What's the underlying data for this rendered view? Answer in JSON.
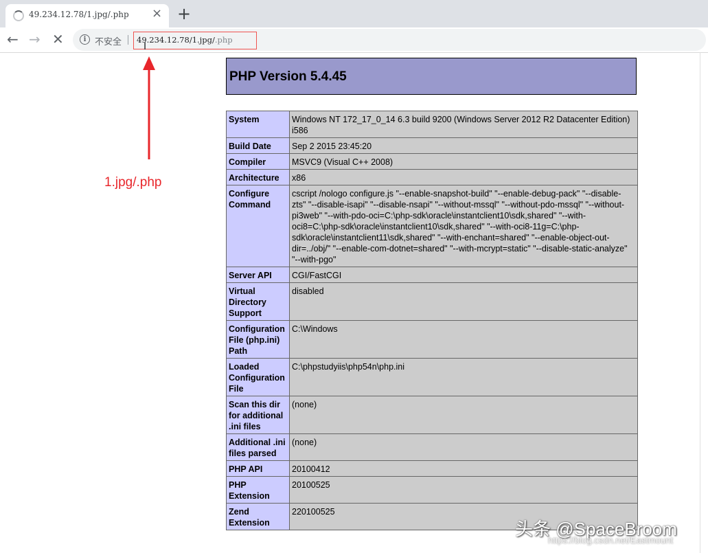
{
  "browser": {
    "tab_title": "49.234.12.78/1.jpg/.php",
    "tab_close": "×",
    "new_tab": "+",
    "back": "←",
    "forward": "→",
    "stop": "✕",
    "info_glyph": "i",
    "security_label": "不安全",
    "url_host": "49.234.12.78/1.jpg/",
    "url_tail": ".php",
    "cursor_glyph": "I"
  },
  "annotation": {
    "label": "1.jpg/.php",
    "color": "#e8262b"
  },
  "php": {
    "title": "PHP Version 5.4.45",
    "header_color": "#9999cc",
    "rows": [
      {
        "name": "System",
        "value": "Windows NT 172_17_0_14 6.3 build 9200 (Windows Server 2012 R2 Datacenter Edition) i586"
      },
      {
        "name": "Build Date",
        "value": "Sep 2 2015 23:45:20"
      },
      {
        "name": "Compiler",
        "value": "MSVC9 (Visual C++ 2008)"
      },
      {
        "name": "Architecture",
        "value": "x86"
      },
      {
        "name": "Configure Command",
        "value": "cscript /nologo configure.js \"--enable-snapshot-build\" \"--enable-debug-pack\" \"--disable-zts\" \"--disable-isapi\" \"--disable-nsapi\" \"--without-mssql\" \"--without-pdo-mssql\" \"--without-pi3web\" \"--with-pdo-oci=C:\\php-sdk\\oracle\\instantclient10\\sdk,shared\" \"--with-oci8=C:\\php-sdk\\oracle\\instantclient10\\sdk,shared\" \"--with-oci8-11g=C:\\php-sdk\\oracle\\instantclient11\\sdk,shared\" \"--with-enchant=shared\" \"--enable-object-out-dir=../obj/\" \"--enable-com-dotnet=shared\" \"--with-mcrypt=static\" \"--disable-static-analyze\" \"--with-pgo\""
      },
      {
        "name": "Server API",
        "value": "CGI/FastCGI"
      },
      {
        "name": "Virtual Directory Support",
        "value": "disabled"
      },
      {
        "name": "Configuration File (php.ini) Path",
        "value": "C:\\Windows"
      },
      {
        "name": "Loaded Configuration File",
        "value": "C:\\phpstudyiis\\php54n\\php.ini"
      },
      {
        "name": "Scan this dir for additional .ini files",
        "value": "(none)"
      },
      {
        "name": "Additional .ini files parsed",
        "value": "(none)"
      },
      {
        "name": "PHP API",
        "value": "20100412"
      },
      {
        "name": "PHP Extension",
        "value": "20100525"
      },
      {
        "name": "Zend Extension",
        "value": "220100525"
      }
    ]
  },
  "watermark": {
    "main": "头条 @SpaceBroom",
    "sub": "https://blog.csdn.net/Eastmount"
  }
}
